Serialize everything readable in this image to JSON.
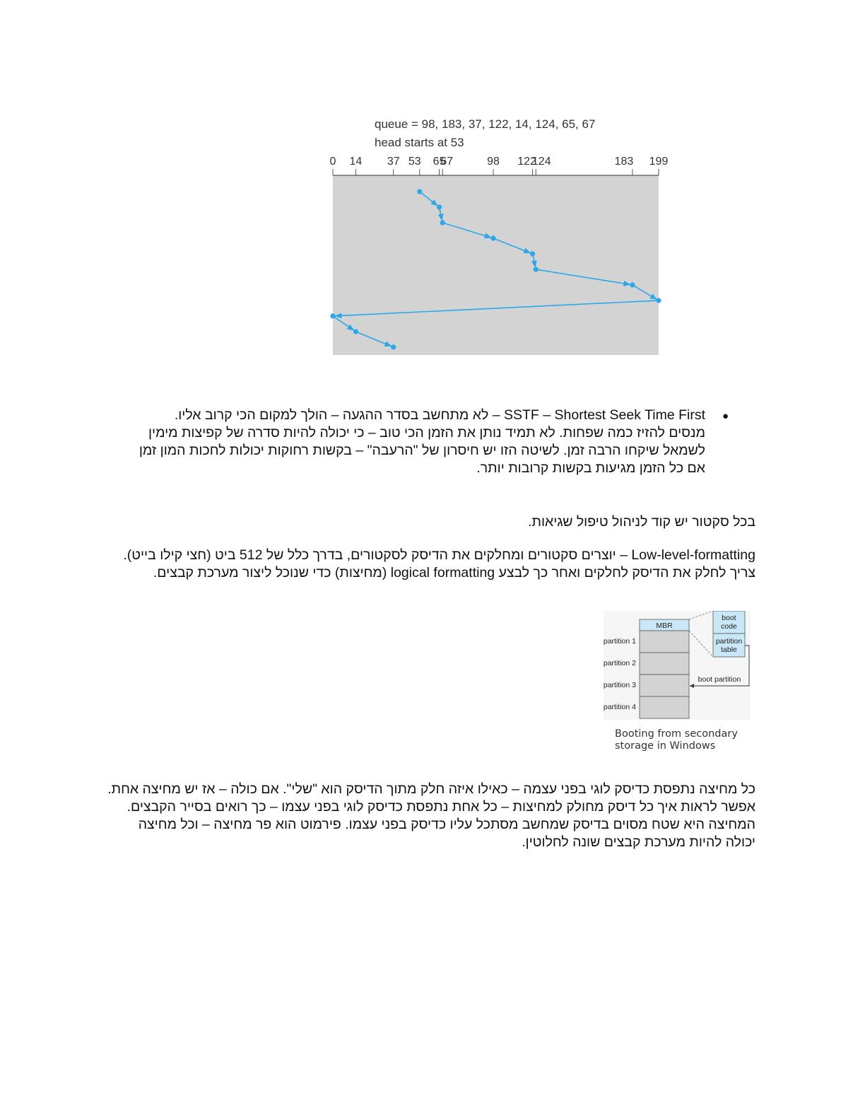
{
  "chart_data": {
    "type": "line",
    "title": "queue = 98, 183, 37, 122, 14, 124, 65, 67",
    "subtitle": "head starts at 53",
    "xlabel": "",
    "ylabel": "",
    "xlim": [
      0,
      199
    ],
    "x_ticks": [
      0,
      14,
      37,
      53,
      65,
      67,
      98,
      122,
      124,
      183,
      199
    ],
    "x_tick_labels": [
      "0",
      "14",
      "37",
      "53",
      "65",
      "67",
      "98",
      "122",
      "124",
      "183",
      "199"
    ],
    "series": [
      {
        "x": [
          53,
          65,
          67,
          98,
          122,
          124,
          183,
          199,
          0,
          14,
          37
        ]
      }
    ],
    "grid": false,
    "colors": {
      "background": "#d3d3d3",
      "line": "#2aa7e8"
    }
  },
  "sstf": {
    "bullet": "●",
    "lines": [
      "SSTF – Shortest Seek Time First – לא מתחשב בסדר ההגעה – הולך למקום הכי קרוב אליו.",
      "מנסים להזיז כמה שפחות. לא תמיד נותן את הזמן הכי טוב – כי יכולה להיות סדרה של קפיצות מימין",
      "לשמאל שיקחו הרבה זמן. לשיטה הזו יש חיסרון של \"הרעבה\" – בקשות רחוקות יכולות לחכות המון זמן",
      "אם כל הזמן מגיעות בקשות קרובות יותר."
    ]
  },
  "sector_line": "בכל סקטור יש קוד לניהול טיפול שגיאות.",
  "formatting": {
    "line1": "Low-level-formatting – יוצרים סקטורים ומחלקים את הדיסק לסקטורים, בדרך כלל של 512 ביט (חצי קילו בייט).",
    "line2": " צריך לחלק את הדיסק לחלקים ואחר כך לבצע logical formatting (מחיצות) כדי שנוכל ליצור מערכת קבצים."
  },
  "mbr_diagram": {
    "mbr": "MBR",
    "partitions": [
      "partition 1",
      "partition 2",
      "partition 3",
      "partition 4"
    ],
    "boot_code": [
      "boot",
      "code"
    ],
    "partition_table": [
      "partition",
      "table"
    ],
    "boot_partition": "boot partition",
    "caption": [
      "Booting from secondary",
      "storage in Windows"
    ],
    "colors": {
      "blue_box": "#c9e8f7",
      "gray_box": "#d3d3d3"
    }
  },
  "partitions_text": {
    "line1": "כל מחיצה נתפסת כדיסק לוגי בפני עצמה – כאילו איזה חלק מתוך הדיסק הוא \"שלי\". אם כולה – אז יש מחיצה אחת.",
    "line2": " אפשר לראות איך כל דיסק מחולק למחיצות – כל אחת נתפסת כדיסק לוגי בפני עצמו – כך רואים בסייר הקבצים.",
    "line3": " המחיצה היא שטח מסוים בדיסק שמחשב מסתכל עליו כדיסק בפני עצמו. פירמוט הוא פר מחיצה – וכל מחיצה",
    "line4": "יכולה להיות מערכת קבצים שונה לחלוטין."
  }
}
